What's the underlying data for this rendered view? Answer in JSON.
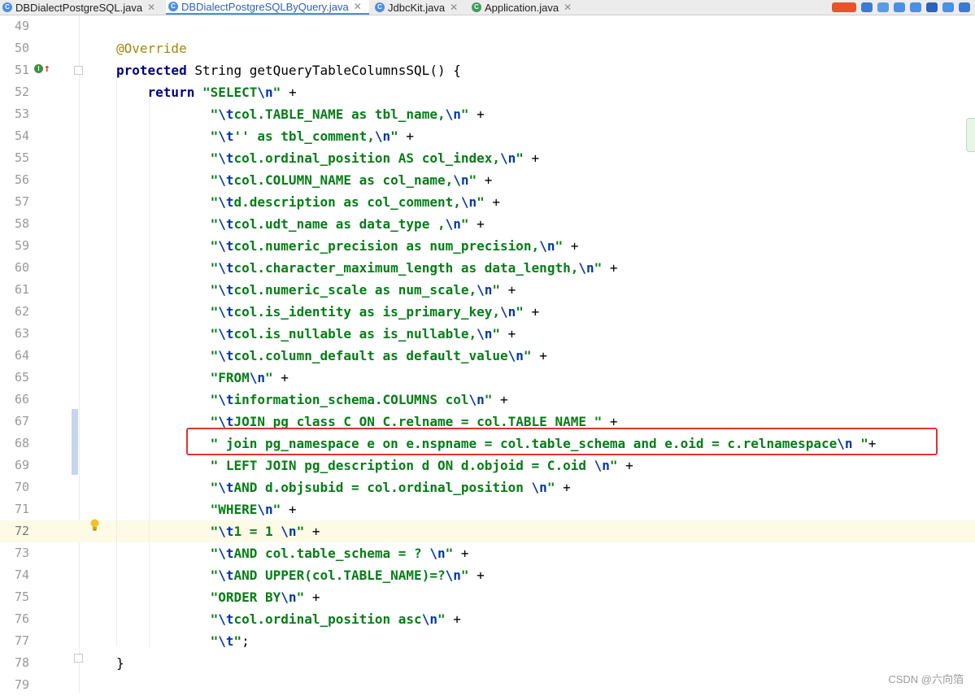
{
  "tabs": [
    {
      "label": "DBDialectPostgreSQL.java",
      "icon": "java-class-icon",
      "active": false
    },
    {
      "label": "DBDialectPostgreSQLByQuery.java",
      "icon": "java-class-icon",
      "active": true
    },
    {
      "label": "JdbcKit.java",
      "icon": "java-class-icon",
      "active": false
    },
    {
      "label": "Application.java",
      "icon": "java-app-class-icon",
      "active": false
    }
  ],
  "colors": {
    "keyword": "#000080",
    "string": "#067d17",
    "escape": "#0037a6",
    "annotation": "#9e880d",
    "highlight_border": "#e0332f",
    "current_line": "#fdfbe6"
  },
  "current_line": "72",
  "highlighted_line": "68",
  "lines": [
    {
      "n": "49",
      "parts": []
    },
    {
      "n": "50",
      "parts": [
        {
          "t": "ann",
          "v": "@Override"
        }
      ]
    },
    {
      "n": "51",
      "parts": [
        {
          "t": "kw",
          "v": "protected "
        },
        {
          "t": "plain",
          "v": "String getQueryTableColumnsSQL() {"
        }
      ]
    },
    {
      "n": "52",
      "parts": [
        {
          "t": "plain",
          "v": "    "
        },
        {
          "t": "kw",
          "v": "return "
        },
        {
          "t": "str",
          "v": "\"SELECT"
        },
        {
          "t": "esc",
          "v": "\\n"
        },
        {
          "t": "str",
          "v": "\""
        },
        {
          "t": "plain",
          "v": " +"
        }
      ]
    },
    {
      "n": "53",
      "parts": [
        {
          "t": "plain",
          "v": "            "
        },
        {
          "t": "str",
          "v": "\""
        },
        {
          "t": "esc",
          "v": "\\t"
        },
        {
          "t": "str",
          "v": "col.TABLE_NAME as tbl_name,"
        },
        {
          "t": "esc",
          "v": "\\n"
        },
        {
          "t": "str",
          "v": "\""
        },
        {
          "t": "plain",
          "v": " +"
        }
      ]
    },
    {
      "n": "54",
      "parts": [
        {
          "t": "plain",
          "v": "            "
        },
        {
          "t": "str",
          "v": "\""
        },
        {
          "t": "esc",
          "v": "\\t"
        },
        {
          "t": "str",
          "v": "'' as tbl_comment,"
        },
        {
          "t": "esc",
          "v": "\\n"
        },
        {
          "t": "str",
          "v": "\""
        },
        {
          "t": "plain",
          "v": " +"
        }
      ]
    },
    {
      "n": "55",
      "parts": [
        {
          "t": "plain",
          "v": "            "
        },
        {
          "t": "str",
          "v": "\""
        },
        {
          "t": "esc",
          "v": "\\t"
        },
        {
          "t": "str",
          "v": "col.ordinal_position AS col_index,"
        },
        {
          "t": "esc",
          "v": "\\n"
        },
        {
          "t": "str",
          "v": "\""
        },
        {
          "t": "plain",
          "v": " +"
        }
      ]
    },
    {
      "n": "56",
      "parts": [
        {
          "t": "plain",
          "v": "            "
        },
        {
          "t": "str",
          "v": "\""
        },
        {
          "t": "esc",
          "v": "\\t"
        },
        {
          "t": "str",
          "v": "col.COLUMN_NAME as col_name,"
        },
        {
          "t": "esc",
          "v": "\\n"
        },
        {
          "t": "str",
          "v": "\""
        },
        {
          "t": "plain",
          "v": " +"
        }
      ]
    },
    {
      "n": "57",
      "parts": [
        {
          "t": "plain",
          "v": "            "
        },
        {
          "t": "str",
          "v": "\""
        },
        {
          "t": "esc",
          "v": "\\t"
        },
        {
          "t": "str",
          "v": "d.description as col_comment,"
        },
        {
          "t": "esc",
          "v": "\\n"
        },
        {
          "t": "str",
          "v": "\""
        },
        {
          "t": "plain",
          "v": " +"
        }
      ]
    },
    {
      "n": "58",
      "parts": [
        {
          "t": "plain",
          "v": "            "
        },
        {
          "t": "str",
          "v": "\""
        },
        {
          "t": "esc",
          "v": "\\t"
        },
        {
          "t": "str",
          "v": "col.udt_name as data_type ,"
        },
        {
          "t": "esc",
          "v": "\\n"
        },
        {
          "t": "str",
          "v": "\""
        },
        {
          "t": "plain",
          "v": " +"
        }
      ]
    },
    {
      "n": "59",
      "parts": [
        {
          "t": "plain",
          "v": "            "
        },
        {
          "t": "str",
          "v": "\""
        },
        {
          "t": "esc",
          "v": "\\t"
        },
        {
          "t": "str",
          "v": "col.numeric_precision as num_precision,"
        },
        {
          "t": "esc",
          "v": "\\n"
        },
        {
          "t": "str",
          "v": "\""
        },
        {
          "t": "plain",
          "v": " +"
        }
      ]
    },
    {
      "n": "60",
      "parts": [
        {
          "t": "plain",
          "v": "            "
        },
        {
          "t": "str",
          "v": "\""
        },
        {
          "t": "esc",
          "v": "\\t"
        },
        {
          "t": "str",
          "v": "col.character_maximum_length as data_length,"
        },
        {
          "t": "esc",
          "v": "\\n"
        },
        {
          "t": "str",
          "v": "\""
        },
        {
          "t": "plain",
          "v": " +"
        }
      ]
    },
    {
      "n": "61",
      "parts": [
        {
          "t": "plain",
          "v": "            "
        },
        {
          "t": "str",
          "v": "\""
        },
        {
          "t": "esc",
          "v": "\\t"
        },
        {
          "t": "str",
          "v": "col.numeric_scale as num_scale,"
        },
        {
          "t": "esc",
          "v": "\\n"
        },
        {
          "t": "str",
          "v": "\""
        },
        {
          "t": "plain",
          "v": " +"
        }
      ]
    },
    {
      "n": "62",
      "parts": [
        {
          "t": "plain",
          "v": "            "
        },
        {
          "t": "str",
          "v": "\""
        },
        {
          "t": "esc",
          "v": "\\t"
        },
        {
          "t": "str",
          "v": "col.is_identity as is_primary_key,"
        },
        {
          "t": "esc",
          "v": "\\n"
        },
        {
          "t": "str",
          "v": "\""
        },
        {
          "t": "plain",
          "v": " +"
        }
      ]
    },
    {
      "n": "63",
      "parts": [
        {
          "t": "plain",
          "v": "            "
        },
        {
          "t": "str",
          "v": "\""
        },
        {
          "t": "esc",
          "v": "\\t"
        },
        {
          "t": "str",
          "v": "col.is_nullable as is_nullable,"
        },
        {
          "t": "esc",
          "v": "\\n"
        },
        {
          "t": "str",
          "v": "\""
        },
        {
          "t": "plain",
          "v": " +"
        }
      ]
    },
    {
      "n": "64",
      "parts": [
        {
          "t": "plain",
          "v": "            "
        },
        {
          "t": "str",
          "v": "\""
        },
        {
          "t": "esc",
          "v": "\\t"
        },
        {
          "t": "str",
          "v": "col.column_default as default_value"
        },
        {
          "t": "esc",
          "v": "\\n"
        },
        {
          "t": "str",
          "v": "\""
        },
        {
          "t": "plain",
          "v": " +"
        }
      ]
    },
    {
      "n": "65",
      "parts": [
        {
          "t": "plain",
          "v": "            "
        },
        {
          "t": "str",
          "v": "\"FROM"
        },
        {
          "t": "esc",
          "v": "\\n"
        },
        {
          "t": "str",
          "v": "\""
        },
        {
          "t": "plain",
          "v": " +"
        }
      ]
    },
    {
      "n": "66",
      "parts": [
        {
          "t": "plain",
          "v": "            "
        },
        {
          "t": "str",
          "v": "\""
        },
        {
          "t": "esc",
          "v": "\\t"
        },
        {
          "t": "str",
          "v": "information_schema.COLUMNS col"
        },
        {
          "t": "esc",
          "v": "\\n"
        },
        {
          "t": "str",
          "v": "\""
        },
        {
          "t": "plain",
          "v": " +"
        }
      ]
    },
    {
      "n": "67",
      "parts": [
        {
          "t": "plain",
          "v": "            "
        },
        {
          "t": "str",
          "v": "\""
        },
        {
          "t": "esc",
          "v": "\\t"
        },
        {
          "t": "str",
          "v": "JOIN pg_class C ON C.relname = col.TABLE_NAME \""
        },
        {
          "t": "plain",
          "v": " +"
        }
      ]
    },
    {
      "n": "68",
      "parts": [
        {
          "t": "plain",
          "v": "            "
        },
        {
          "t": "str",
          "v": "\" join pg_namespace e on e.nspname = col.table_schema and e.oid = c.relnamespace"
        },
        {
          "t": "esc",
          "v": "\\n"
        },
        {
          "t": "str",
          "v": " \""
        },
        {
          "t": "plain",
          "v": "+"
        }
      ]
    },
    {
      "n": "69",
      "parts": [
        {
          "t": "plain",
          "v": "            "
        },
        {
          "t": "str",
          "v": "\" LEFT JOIN pg_description d ON d.objoid = C.oid "
        },
        {
          "t": "esc",
          "v": "\\n"
        },
        {
          "t": "str",
          "v": "\""
        },
        {
          "t": "plain",
          "v": " +"
        }
      ]
    },
    {
      "n": "70",
      "parts": [
        {
          "t": "plain",
          "v": "            "
        },
        {
          "t": "str",
          "v": "\""
        },
        {
          "t": "esc",
          "v": "\\t"
        },
        {
          "t": "str",
          "v": "AND d.objsubid = col.ordinal_position "
        },
        {
          "t": "esc",
          "v": "\\n"
        },
        {
          "t": "str",
          "v": "\""
        },
        {
          "t": "plain",
          "v": " +"
        }
      ]
    },
    {
      "n": "71",
      "parts": [
        {
          "t": "plain",
          "v": "            "
        },
        {
          "t": "str",
          "v": "\"WHERE"
        },
        {
          "t": "esc",
          "v": "\\n"
        },
        {
          "t": "str",
          "v": "\""
        },
        {
          "t": "plain",
          "v": " +"
        }
      ]
    },
    {
      "n": "72",
      "parts": [
        {
          "t": "plain",
          "v": "            "
        },
        {
          "t": "str",
          "v": "\""
        },
        {
          "t": "esc",
          "v": "\\t"
        },
        {
          "t": "str",
          "v": "1 = 1 "
        },
        {
          "t": "esc",
          "v": "\\n"
        },
        {
          "t": "str",
          "v": "\""
        },
        {
          "t": "plain",
          "v": " +"
        }
      ]
    },
    {
      "n": "73",
      "parts": [
        {
          "t": "plain",
          "v": "            "
        },
        {
          "t": "str",
          "v": "\""
        },
        {
          "t": "esc",
          "v": "\\t"
        },
        {
          "t": "str",
          "v": "AND col.table_schema = ? "
        },
        {
          "t": "esc",
          "v": "\\n"
        },
        {
          "t": "str",
          "v": "\""
        },
        {
          "t": "plain",
          "v": " +"
        }
      ]
    },
    {
      "n": "74",
      "parts": [
        {
          "t": "plain",
          "v": "            "
        },
        {
          "t": "str",
          "v": "\""
        },
        {
          "t": "esc",
          "v": "\\t"
        },
        {
          "t": "str",
          "v": "AND UPPER(col.TABLE_NAME)=?"
        },
        {
          "t": "esc",
          "v": "\\n"
        },
        {
          "t": "str",
          "v": "\""
        },
        {
          "t": "plain",
          "v": " +"
        }
      ]
    },
    {
      "n": "75",
      "parts": [
        {
          "t": "plain",
          "v": "            "
        },
        {
          "t": "str",
          "v": "\"ORDER BY"
        },
        {
          "t": "esc",
          "v": "\\n"
        },
        {
          "t": "str",
          "v": "\""
        },
        {
          "t": "plain",
          "v": " +"
        }
      ]
    },
    {
      "n": "76",
      "parts": [
        {
          "t": "plain",
          "v": "            "
        },
        {
          "t": "str",
          "v": "\""
        },
        {
          "t": "esc",
          "v": "\\t"
        },
        {
          "t": "str",
          "v": "col.ordinal_position asc"
        },
        {
          "t": "esc",
          "v": "\\n"
        },
        {
          "t": "str",
          "v": "\""
        },
        {
          "t": "plain",
          "v": " +"
        }
      ]
    },
    {
      "n": "77",
      "parts": [
        {
          "t": "plain",
          "v": "            "
        },
        {
          "t": "str",
          "v": "\""
        },
        {
          "t": "esc",
          "v": "\\t"
        },
        {
          "t": "str",
          "v": "\""
        },
        {
          "t": "plain",
          "v": ";"
        }
      ]
    },
    {
      "n": "78",
      "parts": [
        {
          "t": "plain",
          "v": "}"
        }
      ]
    },
    {
      "n": "79",
      "parts": []
    }
  ],
  "gutter": {
    "override_marker_label": "I",
    "override_marker_icon": "implements-override-icon",
    "intention_icon": "lightbulb-icon"
  },
  "watermark": "CSDN @六向箔"
}
